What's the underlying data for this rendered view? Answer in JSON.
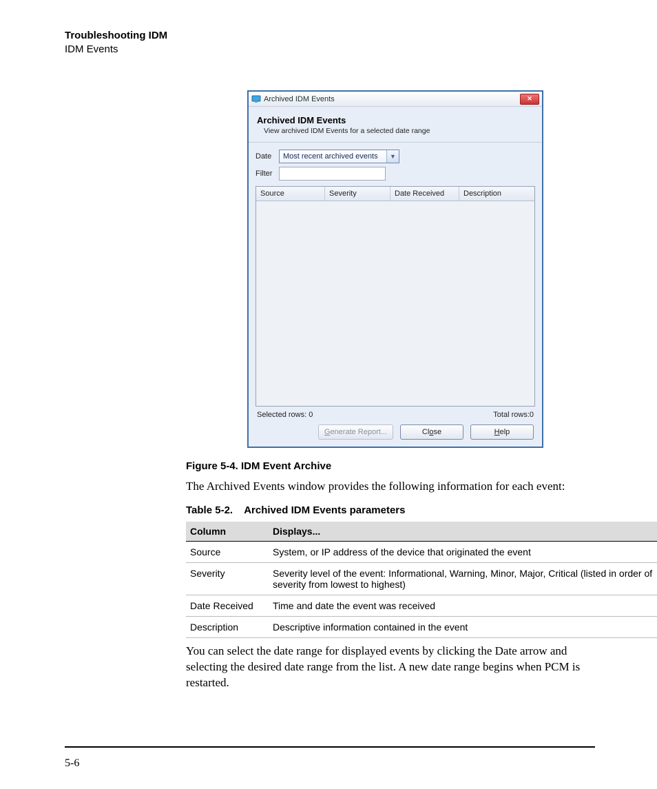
{
  "header": {
    "title": "Troubleshooting IDM",
    "subtitle": "IDM Events"
  },
  "dialog": {
    "window_title": "Archived IDM Events",
    "heading": "Archived IDM Events",
    "subheading": "View archived IDM Events for a selected date range",
    "labels": {
      "date": "Date",
      "filter": "Filter"
    },
    "date_selected": "Most recent archived events",
    "filter_value": "",
    "columns": {
      "source": "Source",
      "severity": "Severity",
      "date_received": "Date Received",
      "description": "Description"
    },
    "status": {
      "selected_rows": "Selected rows: 0",
      "total_rows": "Total rows:0"
    },
    "buttons": {
      "generate": {
        "pre": "",
        "u": "G",
        "post": "enerate Report..."
      },
      "close": {
        "pre": "Cl",
        "u": "o",
        "post": "se"
      },
      "help": {
        "pre": "",
        "u": "H",
        "post": "elp"
      }
    }
  },
  "figure_caption": "Figure 5-4. IDM Event Archive",
  "para_intro": "The Archived Events window provides the following information for each event:",
  "table_caption_prefix": "Table 5-2.",
  "table_caption_title": "Archived IDM Events parameters",
  "param_table": {
    "head": {
      "c1": "Column",
      "c2": "Displays..."
    },
    "rows": [
      {
        "c1": "Source",
        "c2": "System, or IP address of the device that originated the event"
      },
      {
        "c1": "Severity",
        "c2": "Severity level of the event: Informational, Warning, Minor, Major, Critical (listed in order of severity from lowest to highest)"
      },
      {
        "c1": "Date Received",
        "c2": "Time and date the event was received"
      },
      {
        "c1": "Description",
        "c2": "Descriptive information contained in the event"
      }
    ]
  },
  "para_after": "You can select the date range for displayed events by clicking the Date arrow and selecting the desired date range from the list. A new date range begins when PCM is restarted.",
  "page_number": "5-6"
}
